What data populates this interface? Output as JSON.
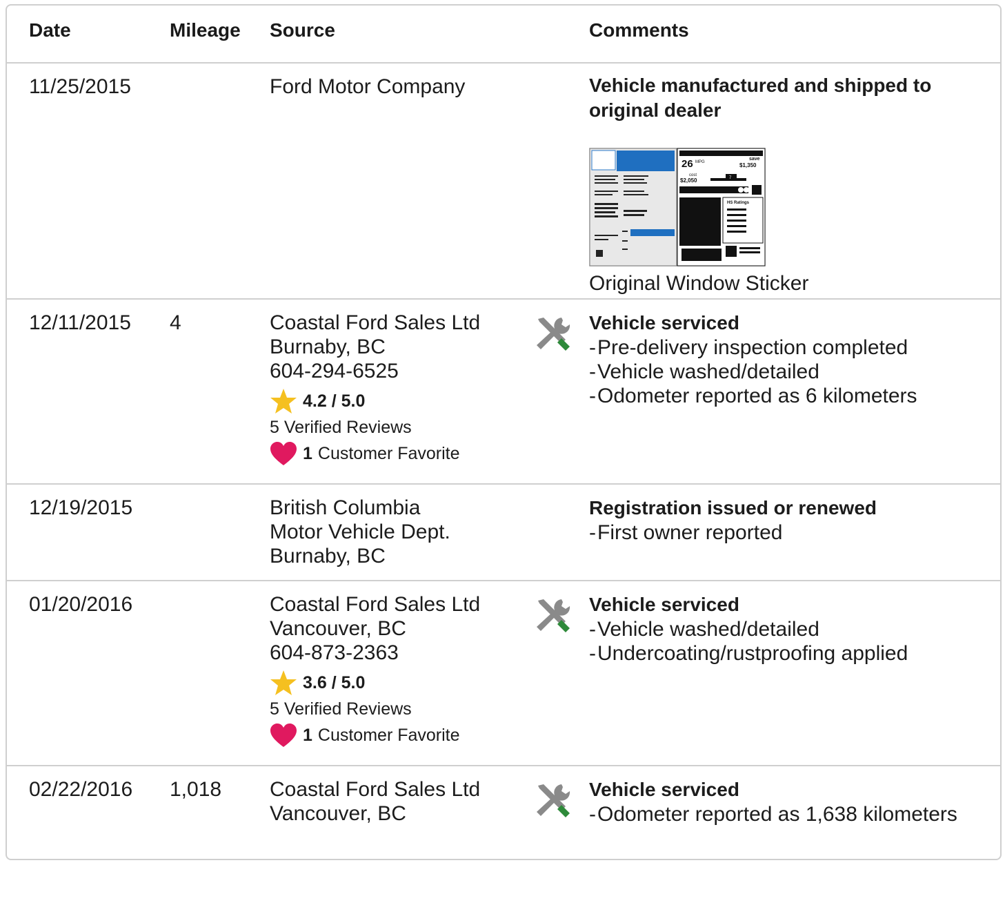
{
  "header": {
    "date": "Date",
    "mileage": "Mileage",
    "source": "Source",
    "comments": "Comments"
  },
  "colors": {
    "star": "#f5c020",
    "heart": "#e0195f",
    "wrench": "#8a8a8a",
    "screwdriver": "#2e8a3a",
    "border": "#cfcfcf"
  },
  "records": [
    {
      "date": "11/25/2015",
      "mileage": "",
      "source": [
        "Ford Motor Company"
      ],
      "title": "Vehicle manufactured and shipped to original dealer",
      "items": [],
      "sticker_caption": "Original Window Sticker",
      "sticker": {
        "mpg": "26",
        "mpg_unit": "MPG",
        "save": "save",
        "save_amount": "$1,350",
        "cost": "cost",
        "cost_amount": "$2,050",
        "ratings": "HS Ratings",
        "ratings_value": "7"
      }
    },
    {
      "date": "12/11/2015",
      "mileage": "4",
      "source": [
        "Coastal Ford Sales Ltd",
        "Burnaby, BC",
        "604-294-6525"
      ],
      "rating": "4.2 / 5.0",
      "reviews": "5 Verified Reviews",
      "favorites_count": "1",
      "favorites_label": "Customer Favorite",
      "title": "Vehicle serviced",
      "items": [
        "Pre-delivery inspection completed",
        "Vehicle washed/detailed",
        "Odometer reported as 6 kilometers"
      ],
      "icon": "service-tools-icon"
    },
    {
      "date": "12/19/2015",
      "mileage": "",
      "source": [
        "British Columbia",
        "Motor Vehicle Dept.",
        "Burnaby, BC"
      ],
      "title": "Registration issued or renewed",
      "items": [
        "First owner reported"
      ]
    },
    {
      "date": "01/20/2016",
      "mileage": "",
      "source": [
        "Coastal Ford Sales Ltd",
        "Vancouver, BC",
        "604-873-2363"
      ],
      "rating": "3.6 / 5.0",
      "reviews": "5 Verified Reviews",
      "favorites_count": "1",
      "favorites_label": "Customer Favorite",
      "title": "Vehicle serviced",
      "items": [
        "Vehicle washed/detailed",
        "Undercoating/rustproofing applied"
      ],
      "icon": "service-tools-icon"
    },
    {
      "date": "02/22/2016",
      "mileage": "1,018",
      "source": [
        "Coastal Ford Sales Ltd",
        "Vancouver, BC"
      ],
      "title": "Vehicle serviced",
      "items": [
        "Odometer reported as 1,638 kilometers"
      ],
      "icon": "service-tools-icon"
    }
  ]
}
